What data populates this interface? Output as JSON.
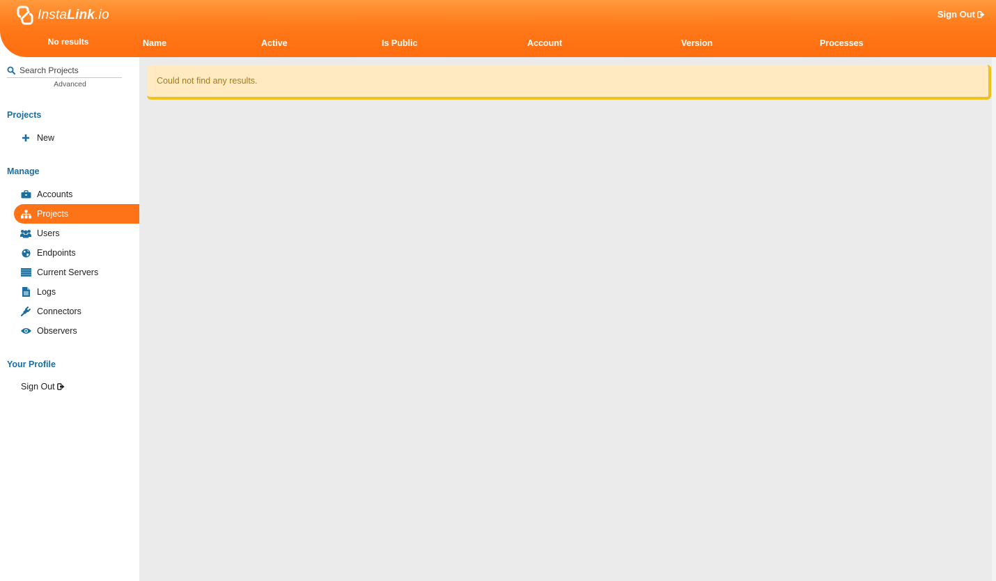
{
  "brand": {
    "name_light": "Insta",
    "name_bold": "Link",
    "name_suffix": ".io"
  },
  "header": {
    "results_label": "No results",
    "sign_out_label": "Sign Out",
    "columns": [
      "Name",
      "Active",
      "Is Public",
      "Account",
      "Version",
      "Processes"
    ]
  },
  "search": {
    "placeholder": "Search Projects",
    "value": "",
    "advanced_label": "Advanced"
  },
  "sidebar": {
    "projects_title": "Projects",
    "projects_items": [
      {
        "label": "New",
        "icon": "plus-icon"
      }
    ],
    "manage_title": "Manage",
    "manage_items": [
      {
        "label": "Accounts",
        "icon": "briefcase-icon"
      },
      {
        "label": "Projects",
        "icon": "sitemap-icon",
        "active": true
      },
      {
        "label": "Users",
        "icon": "users-icon"
      },
      {
        "label": "Endpoints",
        "icon": "globe-icon"
      },
      {
        "label": "Current Servers",
        "icon": "server-icon"
      },
      {
        "label": "Logs",
        "icon": "file-icon"
      },
      {
        "label": "Connectors",
        "icon": "plug-icon"
      },
      {
        "label": "Observers",
        "icon": "eye-icon"
      }
    ],
    "profile_title": "Your Profile",
    "profile_sign_out": "Sign Out"
  },
  "main": {
    "alert_text": "Could not find any results."
  },
  "colors": {
    "header_orange": "#ff7318",
    "accent_blue": "#1a6fa0",
    "alert_bg": "#ffeac2",
    "alert_border": "#f1c21c",
    "alert_text": "#a37b1a"
  }
}
